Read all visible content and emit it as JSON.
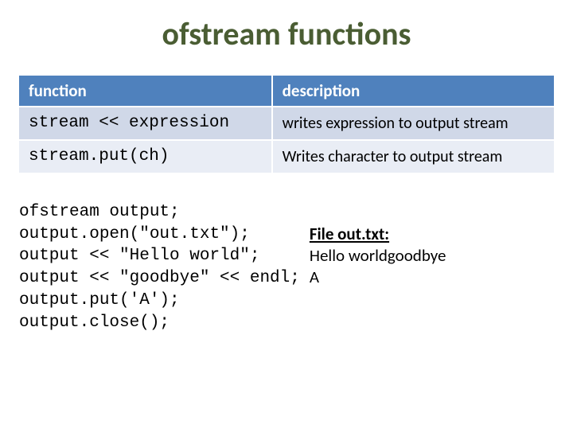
{
  "title": "ofstream functions",
  "table": {
    "headers": [
      "function",
      "description"
    ],
    "rows": [
      {
        "func": "stream << expression",
        "desc": "writes expression to output stream"
      },
      {
        "func": "stream.put(ch)",
        "desc": "Writes character to output stream"
      }
    ]
  },
  "code": [
    "ofstream output;",
    "output.open(\"out.txt\");",
    "output << \"Hello world\";",
    "output << \"goodbye\" << endl;",
    "output.put('A');",
    "output.close();"
  ],
  "file": {
    "title": "File out.txt:",
    "lines": [
      "Hello worldgoodbye",
      "A"
    ]
  }
}
